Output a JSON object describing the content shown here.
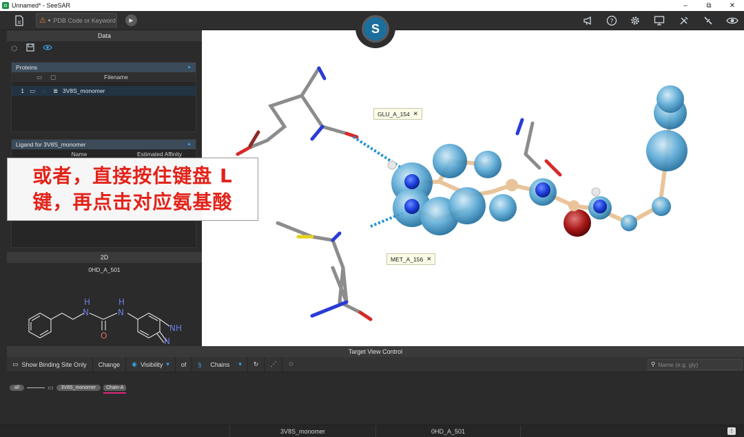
{
  "window": {
    "title": "Unnamed* - SeeSAR",
    "min": "–",
    "max": "⧉",
    "close": "✕"
  },
  "toolbar": {
    "search_placeholder": "PDB Code or Keyword",
    "logo_glyph": "S",
    "icons": [
      "file-icon",
      "warning-icon",
      "play-icon",
      "megaphone-icon",
      "help-icon",
      "settings-icon",
      "monitor-icon",
      "tools-icon",
      "satellite-icon",
      "eye-icon"
    ]
  },
  "data_panel": {
    "title": "Data",
    "proteins": {
      "section": "Proteins",
      "col_filename": "Filename",
      "rows": [
        {
          "index": "1",
          "filename": "3V8S_monomer"
        }
      ]
    },
    "ligands": {
      "section": "Ligand for 3V8S_monomer",
      "col_name": "Name",
      "col_affinity": "Estimated Affinity"
    }
  },
  "twod": {
    "title": "2D",
    "ligand_name": "0HD_A_501",
    "atoms": {
      "h1": "H",
      "n1": "N",
      "h2": "H",
      "n2": "N",
      "o": "O",
      "nh": "NH",
      "n3": "N"
    }
  },
  "viewer": {
    "labels": [
      {
        "text": "GLU_A_154",
        "close": "✕"
      },
      {
        "text": "MET_A_156",
        "close": "✕"
      }
    ]
  },
  "overlay": {
    "line1": "或者，直接按住键盘 L",
    "line2": "键，再点击对应氨基酸"
  },
  "target_view_control": {
    "title": "Target View Control",
    "show_binding_site": "Show Binding Site Only",
    "change": "Change",
    "visibility": "Visibility",
    "of": "of",
    "chains": "Chains",
    "search_placeholder": "Name (e.g. gly)",
    "chain_all": "all",
    "chain_protein": "3V8S_monomer",
    "chain_a": "Chain-A"
  },
  "statusbar": {
    "protein": "3V8S_monomer",
    "ligand": "0HD_A_501"
  },
  "colors": {
    "accent": "#39a0e8",
    "chain_underline": "#e0267a",
    "overlay_text": "#e2231a"
  }
}
